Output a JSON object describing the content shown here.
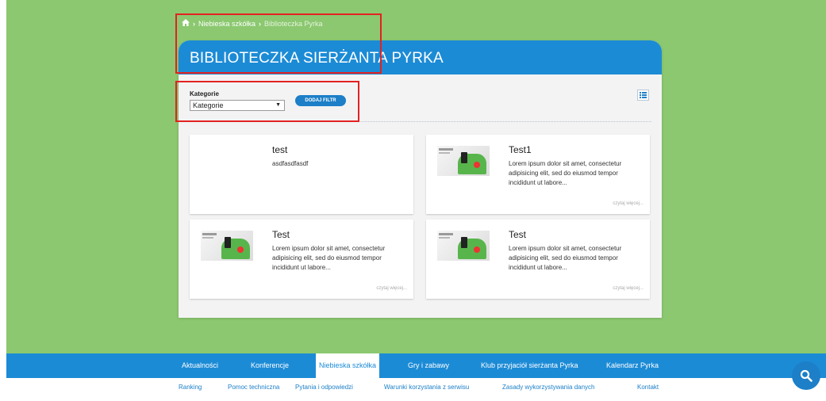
{
  "breadcrumb": {
    "home_icon": "home-icon",
    "separator_icon": "chevron-right-icon",
    "item1": "Niebieska szkółka",
    "item2": "Biblioteczka Pyrka"
  },
  "page": {
    "title": "BIBLIOTECZKA SIERŻANTA PYRKA",
    "header_color": "#1c8bd6",
    "background_color": "#8bc86f"
  },
  "filter": {
    "label": "Kategorie",
    "selected": "Kategorie",
    "add_button": "DODAJ FILTR",
    "view_icon": "list-icon"
  },
  "items": [
    {
      "title": "test",
      "desc": "asdfasdfasdf",
      "has_thumb": false,
      "more": ""
    },
    {
      "title": "Test1",
      "desc": "Lorem ipsum dolor sit amet, consectetur adipisicing elit, sed do eiusmod tempor incididunt ut labore...",
      "has_thumb": true,
      "more": "czytaj więcej..."
    },
    {
      "title": "Test",
      "desc": "Lorem ipsum dolor sit amet, consectetur adipisicing elit, sed do eiusmod tempor incididunt ut labore...",
      "has_thumb": true,
      "more": "czytaj więcej..."
    },
    {
      "title": "Test",
      "desc": "Lorem ipsum dolor sit amet, consectetur adipisicing elit, sed do eiusmod tempor incididunt ut labore...",
      "has_thumb": true,
      "more": "czytaj więcej..."
    }
  ],
  "nav": {
    "items": [
      "Aktualności",
      "Konferencje",
      "Niebieska szkółka",
      "Gry i zabawy",
      "Klub przyjaciół sierżanta Pyrka",
      "Kalendarz Pyrka"
    ],
    "active": "Niebieska szkółka"
  },
  "footer": {
    "items": [
      "Ranking",
      "Pomoc techniczna",
      "Pytania i odpowiedzi",
      "Warunki korzystania z serwisu",
      "Zasady wykorzystywania danych",
      "Kontakt"
    ]
  },
  "search_icon": "search-icon"
}
